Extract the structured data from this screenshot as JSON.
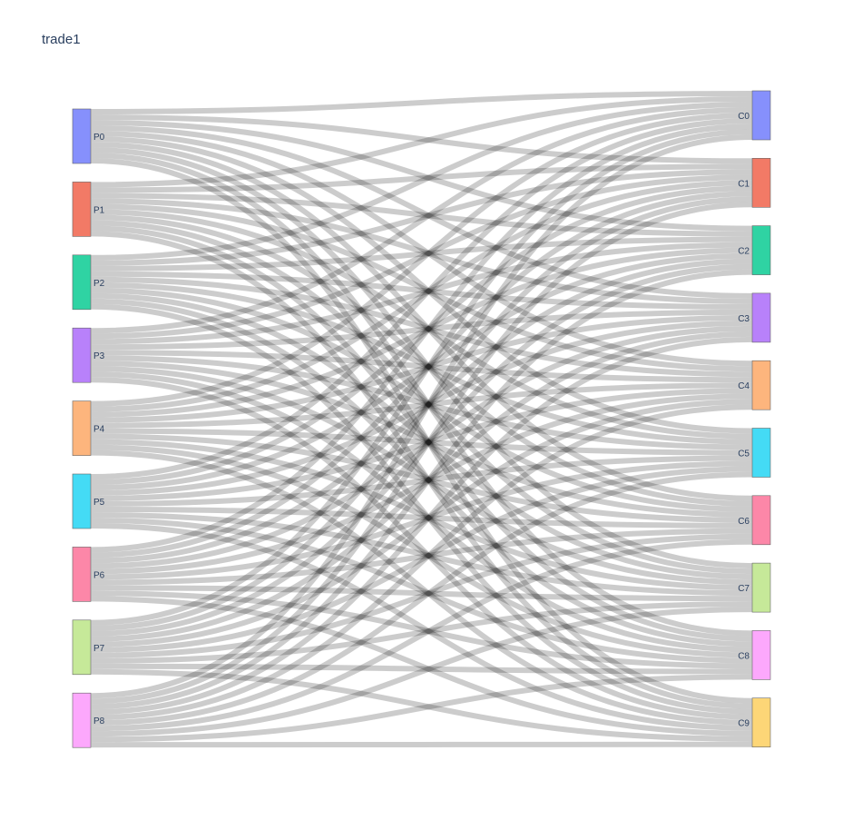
{
  "title": "trade1",
  "chart_data": {
    "type": "sankey",
    "title": "trade1",
    "source_nodes": [
      {
        "label": "P0",
        "color": "#8690fc"
      },
      {
        "label": "P1",
        "color": "#f27a66"
      },
      {
        "label": "P2",
        "color": "#2fd3a3"
      },
      {
        "label": "P3",
        "color": "#b881fa"
      },
      {
        "label": "P4",
        "color": "#fdb57d"
      },
      {
        "label": "P5",
        "color": "#44dbf5"
      },
      {
        "label": "P6",
        "color": "#fc87a8"
      },
      {
        "label": "P7",
        "color": "#c6e999"
      },
      {
        "label": "P8",
        "color": "#fca8fc"
      }
    ],
    "target_nodes": [
      {
        "label": "C0",
        "color": "#8690fc"
      },
      {
        "label": "C1",
        "color": "#f27a66"
      },
      {
        "label": "C2",
        "color": "#2fd3a3"
      },
      {
        "label": "C3",
        "color": "#b881fa"
      },
      {
        "label": "C4",
        "color": "#fdb57d"
      },
      {
        "label": "C5",
        "color": "#44dbf5"
      },
      {
        "label": "C6",
        "color": "#fc87a8"
      },
      {
        "label": "C7",
        "color": "#c6e999"
      },
      {
        "label": "C8",
        "color": "#fca8fc"
      },
      {
        "label": "C9",
        "color": "#fdd677"
      }
    ],
    "link_value": 1,
    "link_color": "rgba(0,0,0,0.2)",
    "links": "every source node P0–P8 links to every target node C0–C9 with equal value"
  }
}
